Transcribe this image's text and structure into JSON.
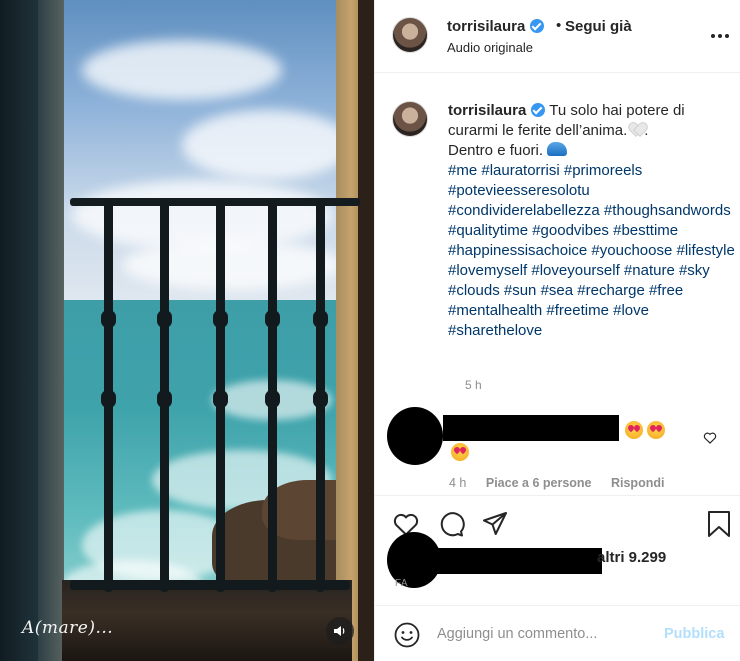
{
  "media": {
    "overlay_text": "A(mare)..."
  },
  "header": {
    "username": "torrisilaura",
    "separator": "•",
    "follow_label": "Segui già",
    "audio_label": "Audio originale"
  },
  "caption": {
    "username": "torrisilaura",
    "text_line1": "Tu solo hai potere di curarmi le ferite dell’anima.",
    "text_line2": ".",
    "text_line3": "Dentro e fuori.",
    "hashtags": "#me #lauratorrisi #primoreels #potevieesseresolotu #condividerelabellezza #thoughsandwords #qualitytime #goodvibes #besttime #happinessisachoice #youchoose #lifestyle #lovemyself #loveyourself #nature #sky #clouds #sun #sea #recharge #free #mentalhealth #freetime #love #sharethelove",
    "time": "5 h"
  },
  "comment": {
    "time": "4 h",
    "likes": "Piace a 6 persone",
    "reply": "Rispondi"
  },
  "actions": {
    "likes_text": "altri 9.299",
    "date_text": "FA"
  },
  "add_comment": {
    "placeholder": "Aggiungi un commento...",
    "publish_label": "Pubblica"
  },
  "colors": {
    "link": "#00376b",
    "verified": "#3897f0",
    "publish_disabled": "#b2dffc",
    "muted": "#8e8e8e"
  },
  "icons": [
    "verified-icon",
    "more-icon",
    "heart-icon",
    "comment-icon",
    "share-icon",
    "save-icon",
    "smile-icon",
    "sound-icon"
  ]
}
